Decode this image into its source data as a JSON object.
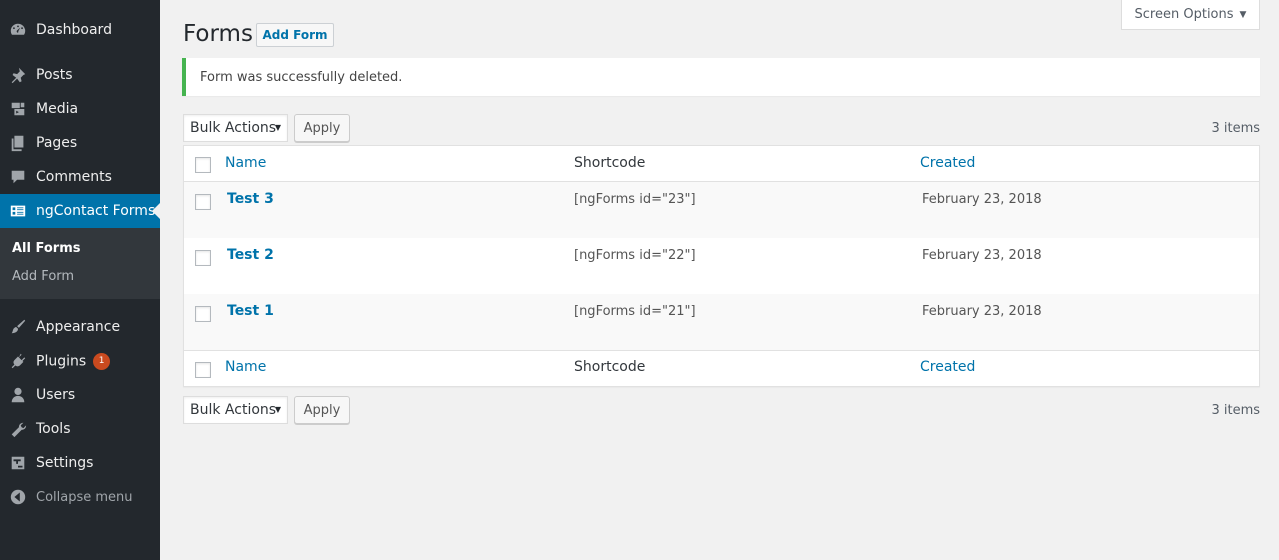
{
  "sidebar": {
    "items": [
      {
        "label": "Dashboard",
        "icon": "dashboard-icon"
      },
      {
        "label": "Posts",
        "icon": "pin-icon"
      },
      {
        "label": "Media",
        "icon": "media-icon"
      },
      {
        "label": "Pages",
        "icon": "pages-icon"
      },
      {
        "label": "Comments",
        "icon": "comment-icon"
      },
      {
        "label": "ngContact Forms",
        "icon": "form-icon"
      },
      {
        "label": "Appearance",
        "icon": "paintbrush-icon"
      },
      {
        "label": "Plugins",
        "icon": "plugin-icon",
        "badge": "1"
      },
      {
        "label": "Users",
        "icon": "user-icon"
      },
      {
        "label": "Tools",
        "icon": "wrench-icon"
      },
      {
        "label": "Settings",
        "icon": "settings-icon"
      }
    ],
    "submenu": [
      "All Forms",
      "Add Form"
    ],
    "collapse_label": "Collapse menu"
  },
  "header": {
    "screen_options": "Screen Options",
    "title": "Forms",
    "add_button": "Add Form"
  },
  "notice": "Form was successfully deleted.",
  "bulk": {
    "select_label": "Bulk Actions",
    "apply_label": "Apply",
    "items_count": "3 items"
  },
  "table": {
    "columns": [
      "Name",
      "Shortcode",
      "Created"
    ],
    "rows": [
      {
        "name": "Test 3",
        "shortcode": "[ngForms id=\"23\"]",
        "created": "February 23, 2018"
      },
      {
        "name": "Test 2",
        "shortcode": "[ngForms id=\"22\"]",
        "created": "February 23, 2018"
      },
      {
        "name": "Test 1",
        "shortcode": "[ngForms id=\"21\"]",
        "created": "February 23, 2018"
      }
    ]
  },
  "colors": {
    "sidebar_bg": "#23282d",
    "accent": "#0073aa",
    "success": "#46b450",
    "badge": "#ca4a1f"
  }
}
